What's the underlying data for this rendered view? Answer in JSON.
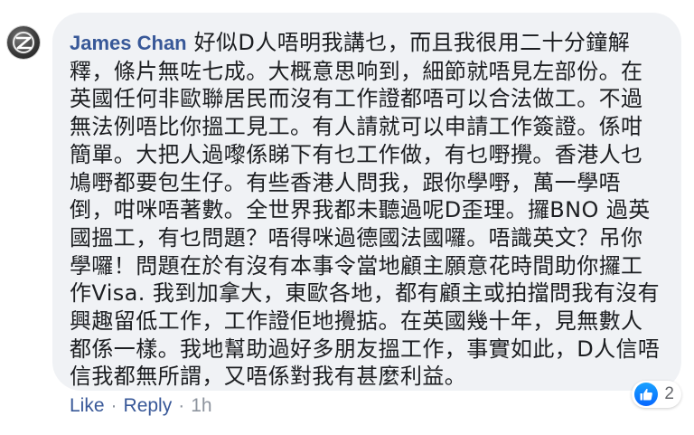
{
  "comment": {
    "author": "James Chan",
    "text": "好似D人唔明我講乜，而且我很用二十分鐘解釋，條片無咗七成。大概意思响到，細節就唔見左部份。在英國任何非歐聯居民而沒有工作證都唔可以合法做工。不過無法例唔比你搵工見工。有人請就可以申請工作簽證。係咁簡單。大把人過嚟係睇下有乜工作做，有乜嘢攪。香港人乜鳩嘢都要包生仔。有些香港人問我，跟你學嘢，萬一學唔倒，咁咪唔著數。全世界我都未聽過呢D歪理。攞BNO 過英國搵工，有乜問題？唔得咪過德國法國囉。唔識英文？吊你學囉！問題在於有沒有本事令當地顧主願意花時間助你攞工作Visa. 我到加拿大，東歐各地，都有顧主或拍擋問我有沒有興趣留低工作，工作證佢地攪掂。在英國幾十年，見無數人都係一樣。我地幫助過好多朋友搵工作，事實如此，D人信唔信我都無所謂，又唔係對我有甚麼利益。"
  },
  "actions": {
    "like_label": "Like",
    "separator": "·",
    "reply_label": "Reply",
    "timestamp": "1h"
  },
  "reactions": {
    "icon": "thumbs-up-icon",
    "count": "2",
    "accent_color": "#1877f2"
  },
  "avatar": {
    "icon": "avatar-logo-icon"
  }
}
